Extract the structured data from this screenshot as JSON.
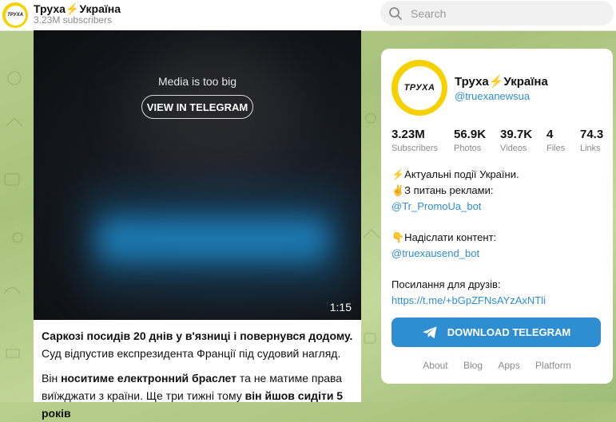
{
  "header": {
    "avatar_text": "ТРУХА",
    "title": "Труха⚡Україна",
    "subscribers": "3.23M subscribers"
  },
  "search": {
    "placeholder": "Search",
    "icon": "search-icon"
  },
  "video": {
    "notice": "Media is too big",
    "button_label": "VIEW IN TELEGRAM",
    "duration": "1:15"
  },
  "message": {
    "p1_bold": "Саркозі посидів 20 днів у в'язниці і повернувся додому.",
    "p1_rest": " Суд відпустив експрезидента Франції під судовий нагляд.",
    "p2_a": "Він ",
    "p2_bold1": "носитиме електронний браслет",
    "p2_b": " та не матиме права виїжджати з країни. Ще три тижні тому ",
    "p2_bold2": "він йшов сидіти 5 років"
  },
  "channel": {
    "avatar_text": "ТРУХА",
    "title": "Труха⚡Україна",
    "handle": "@truexanewsua",
    "stats": [
      {
        "value": "3.23M",
        "label": "Subscribers"
      },
      {
        "value": "56.9K",
        "label": "Photos"
      },
      {
        "value": "39.7K",
        "label": "Videos"
      },
      {
        "value": "4",
        "label": "Files"
      },
      {
        "value": "74.3",
        "label": "Links"
      }
    ],
    "description": {
      "line1": "⚡Актуальні події України.",
      "line2": "✌З питань реклами:",
      "link1": "@Tr_PromoUa_bot",
      "line3": "👇Надіслати контент:",
      "link2": "@truexausend_bot",
      "line4": "Посилання для друзів:",
      "link3": "https://t.me/+bGpZFNsAYzAxNTli"
    },
    "download_label": "DOWNLOAD TELEGRAM",
    "footer_links": [
      "About",
      "Blog",
      "Apps",
      "Platform"
    ]
  },
  "colors": {
    "accent": "#2e8ed1",
    "avatar_yellow": "#f6d100",
    "background": "#b9cf8c"
  }
}
